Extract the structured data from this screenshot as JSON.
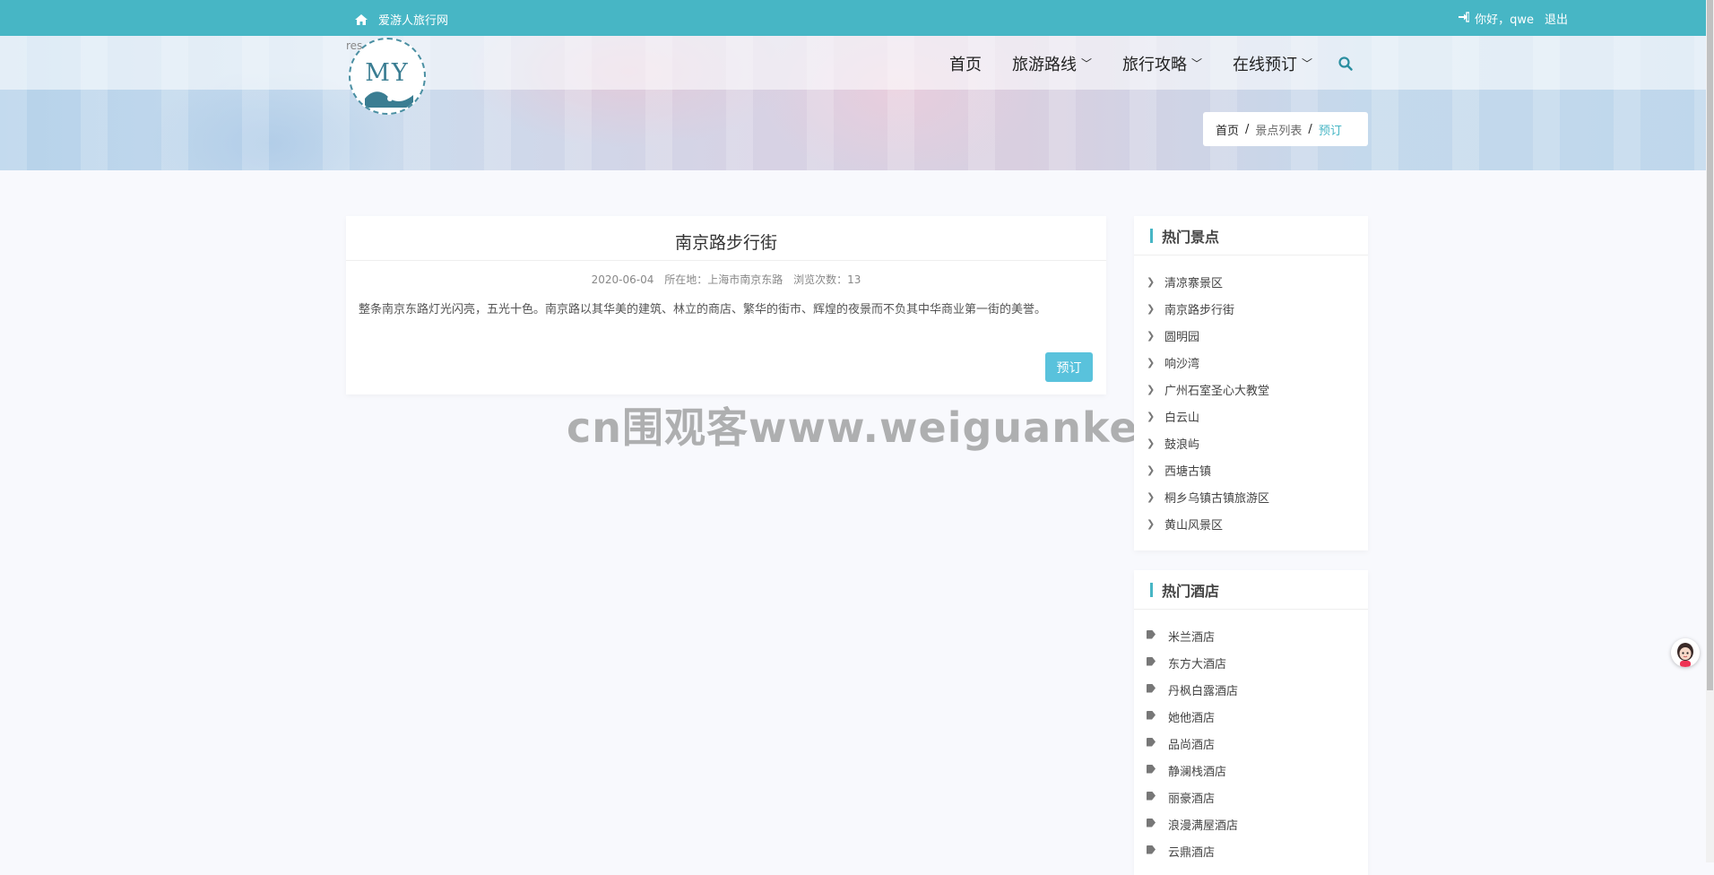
{
  "topbar": {
    "site_name": "爱游人旅行网",
    "greeting": "你好，qwe",
    "logout": "退出"
  },
  "logo": {
    "text": "MY",
    "overlay_text": "res"
  },
  "nav": {
    "items": [
      {
        "label": "首页"
      },
      {
        "label": "旅游路线"
      },
      {
        "label": "旅行攻略"
      },
      {
        "label": "在线预订"
      }
    ]
  },
  "breadcrumb": {
    "home": "首页",
    "middle": "景点列表",
    "current": "预订",
    "separator": "/"
  },
  "spot": {
    "title": "南京路步行街",
    "date": "2020-06-04",
    "location": "所在地：上海市南京东路",
    "views": "浏览次数：13",
    "description": "整条南京东路灯光闪亮，五光十色。南京路以其华美的建筑、林立的商店、繁华的街市、辉煌的夜景而不负其中华商业第一街的美誉。",
    "book_button": "预订"
  },
  "watermark": "cn围观客www.weiguanke.cn",
  "sidebar": {
    "hot_spots_title": "热门景点",
    "hot_spots": [
      "清凉寨景区",
      "南京路步行街",
      "圆明园",
      "响沙湾",
      "广州石室圣心大教堂",
      "白云山",
      "鼓浪屿",
      "西塘古镇",
      "桐乡乌镇古镇旅游区",
      "黄山风景区"
    ],
    "hot_hotels_title": "热门酒店",
    "hot_hotels": [
      "米兰酒店",
      "东方大酒店",
      "丹枫白露酒店",
      "她他酒店",
      "品尚酒店",
      "静澜栈酒店",
      "丽豪酒店",
      "浪漫满屋酒店",
      "云鼎酒店"
    ]
  },
  "colors": {
    "accent": "#47b6c5",
    "button": "#59c2dc"
  }
}
